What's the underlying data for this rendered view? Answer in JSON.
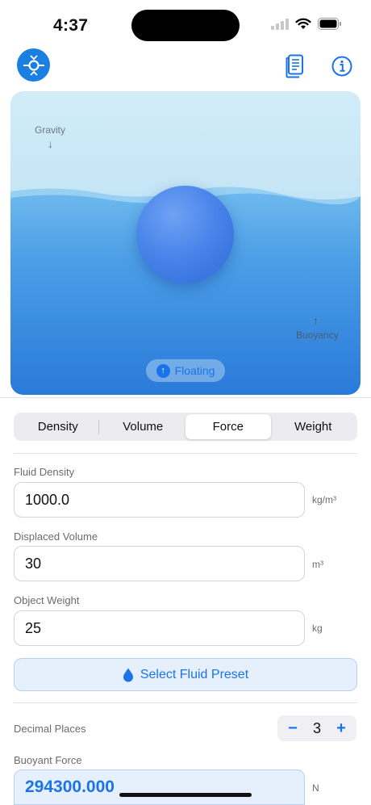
{
  "status_bar": {
    "time": "4:37"
  },
  "simulation": {
    "gravity_label": "Gravity",
    "gravity_arrow": "↓",
    "buoyancy_label": "Buoyancy",
    "buoyancy_arrow": "↑",
    "status": "Floating",
    "status_icon": "↑",
    "colors": {
      "water_top": "#6db8ee",
      "water_bottom": "#2a7ad9",
      "ball": "#4a85ea"
    }
  },
  "tabs": [
    {
      "label": "Density",
      "active": false
    },
    {
      "label": "Volume",
      "active": false
    },
    {
      "label": "Force",
      "active": true
    },
    {
      "label": "Weight",
      "active": false
    }
  ],
  "fields": {
    "fluid_density": {
      "label": "Fluid Density",
      "value": "1000.0",
      "unit": "kg/m³"
    },
    "displaced_volume": {
      "label": "Displaced Volume",
      "value": "30",
      "unit": "m³"
    },
    "object_weight": {
      "label": "Object Weight",
      "value": "25",
      "unit": "kg"
    }
  },
  "preset_button": {
    "label": "Select Fluid Preset",
    "icon": "drop-icon"
  },
  "decimal_places": {
    "label": "Decimal Places",
    "value": "3",
    "minus": "−",
    "plus": "+"
  },
  "result": {
    "label": "Buoyant Force",
    "value": "294300.000",
    "unit": "N"
  },
  "accent_color": "#1a73e8"
}
